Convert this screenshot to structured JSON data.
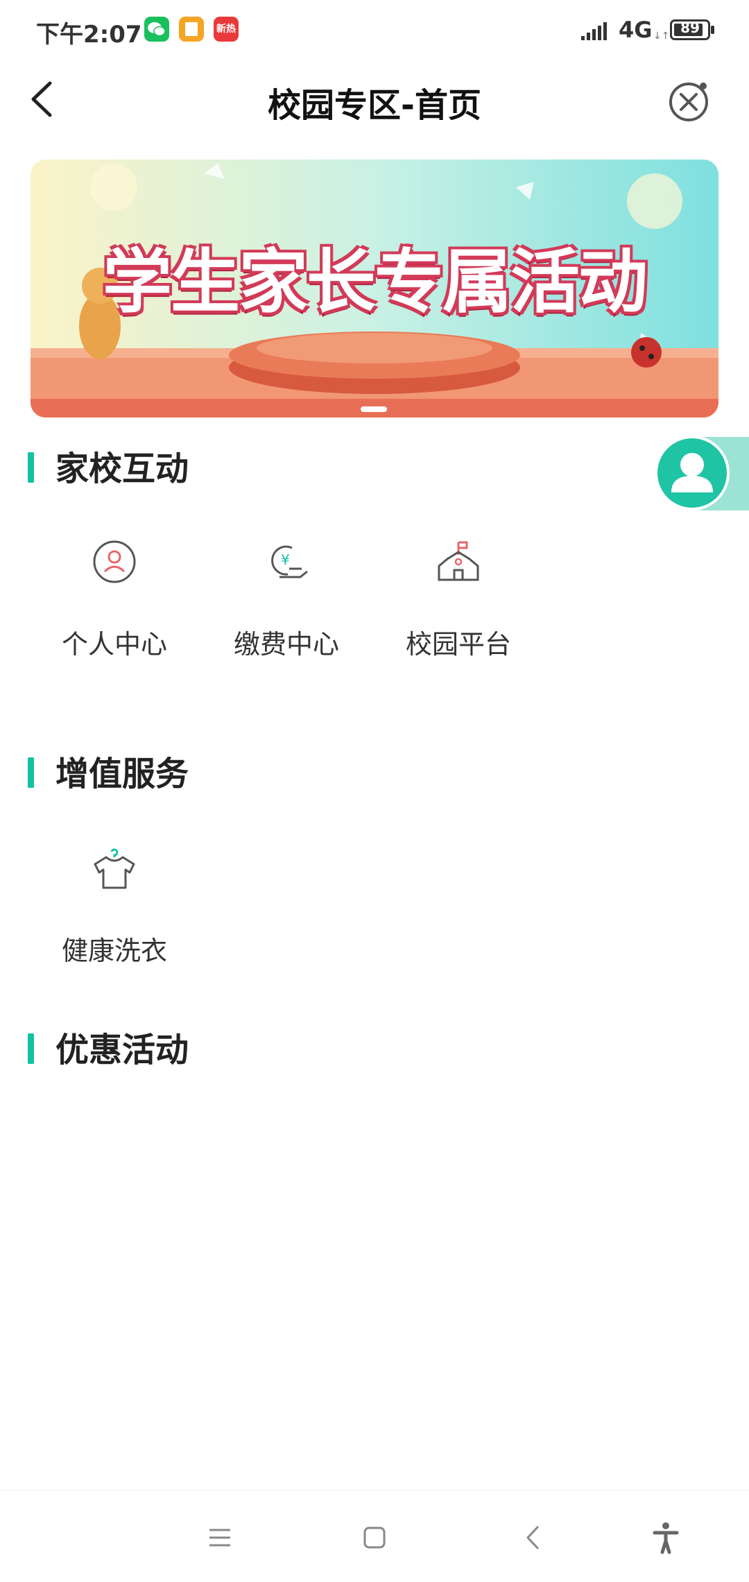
{
  "status_bar": {
    "time": "下午2:07",
    "network": "4G",
    "battery": "89",
    "battery_level": 0.89,
    "apps": [
      {
        "name": "wechat-icon",
        "color": "#19c05d"
      },
      {
        "name": "notes-icon",
        "color": "#f5a524"
      },
      {
        "name": "news-icon",
        "color": "#e83a3a",
        "text": "新热"
      }
    ]
  },
  "header": {
    "title": "校园专区-首页"
  },
  "banner": {
    "text": "学生家长专属活动",
    "colors": {
      "sky_top": "#d9f3e8",
      "sky": "#bfeee6",
      "floor": "#f29774",
      "stage": "#e56a4a"
    }
  },
  "sections": {
    "home_school": {
      "title": "家校互动",
      "items": [
        {
          "label": "个人中心",
          "icon": "person-circle-icon"
        },
        {
          "label": "缴费中心",
          "icon": "payment-hand-icon"
        },
        {
          "label": "校园平台",
          "icon": "school-building-icon"
        }
      ]
    },
    "value_added": {
      "title": "增值服务",
      "items": [
        {
          "label": "健康洗衣",
          "icon": "tshirt-hanger-icon"
        }
      ]
    },
    "promotions": {
      "title": "优惠活动"
    }
  },
  "accent_color": "#12c2a2",
  "icon_accent_color": "#e8666b"
}
